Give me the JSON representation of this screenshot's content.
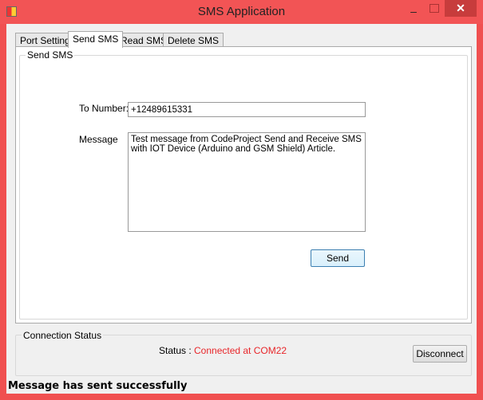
{
  "window": {
    "title": "SMS Application",
    "minimize": "–",
    "close": "✕"
  },
  "tabs": [
    "Port Settings",
    "Send SMS",
    "Read SMS",
    "Delete SMS"
  ],
  "send_sms": {
    "group_label": "Send SMS",
    "to_label": "To Number:",
    "to_value": "+12489615331",
    "message_label": "Message",
    "message_value": "Test message from CodeProject Send and Receive SMS with IOT Device (Arduino and GSM Shield) Article.",
    "send_button": "Send"
  },
  "connection": {
    "group_label": "Connection Status",
    "status_label": "Status :",
    "status_value": "Connected at COM22",
    "status_color": "#e8262a",
    "disconnect_button": "Disconnect"
  },
  "statusbar": {
    "text": "Message has sent successfully"
  }
}
